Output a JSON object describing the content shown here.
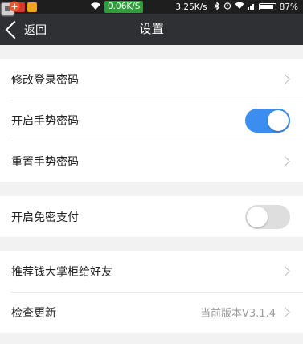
{
  "status_bar": {
    "net_speed": "0.06K/S",
    "speed": "3.25K/s",
    "battery": "87%",
    "accent_color": "#2e9e3b"
  },
  "nav": {
    "back_label": "返回",
    "title": "设置"
  },
  "groups": [
    {
      "rows": [
        {
          "label": "修改登录密码",
          "control": "chevron"
        },
        {
          "label": "开启手势密码",
          "control": "toggle",
          "checked": true
        },
        {
          "label": "重置手势密码",
          "control": "chevron"
        }
      ]
    },
    {
      "rows": [
        {
          "label": "开启免密支付",
          "control": "toggle",
          "checked": false
        }
      ]
    },
    {
      "rows": [
        {
          "label": "推荐钱大掌柜给好友",
          "control": "chevron"
        },
        {
          "label": "检查更新",
          "value": "当前版本V3.1.4",
          "control": "chevron"
        }
      ]
    }
  ],
  "colors": {
    "toggle_on": "#3b8df0",
    "nav_bg": "#2f3033"
  }
}
